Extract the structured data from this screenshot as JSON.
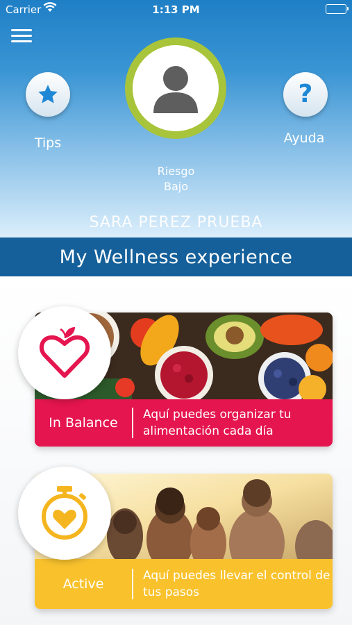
{
  "status_bar": {
    "carrier": "Carrier",
    "time": "1:13 PM"
  },
  "header": {
    "tips_label": "Tips",
    "help_label": "Ayuda",
    "risk_line1": "Riesgo",
    "risk_line2": "Bajo",
    "user_name": "SARA PEREZ PRUEBA",
    "ring_color": "#a8c43a"
  },
  "banner": {
    "title": "My Wellness experience"
  },
  "cards": [
    {
      "name": "In Balance",
      "description": "Aquí puedes organizar tu alimentación cada día",
      "color": "#e5154f",
      "icon": "apple-heart-icon"
    },
    {
      "name": "Active",
      "description": "Aquí puedes llevar el control de tus pasos",
      "color": "#f9c22d",
      "icon": "stopwatch-heart-icon"
    }
  ]
}
